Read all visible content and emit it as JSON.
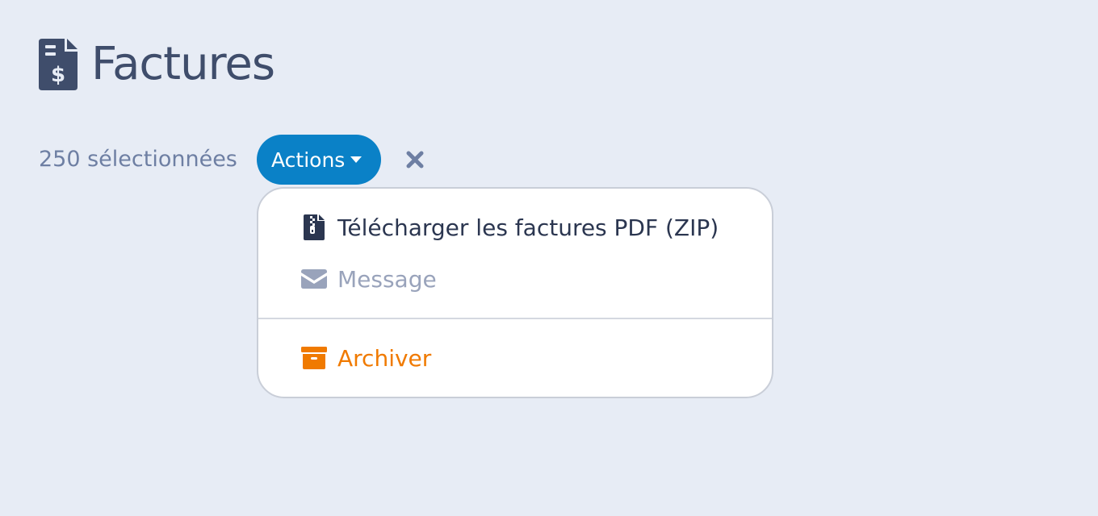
{
  "page": {
    "title": "Factures",
    "title_icon": "file-invoice-dollar-icon"
  },
  "selection": {
    "count_label": "250 sélectionnées",
    "actions_label": "Actions",
    "clear_icon": "close-icon"
  },
  "dropdown": {
    "items": [
      {
        "label": "Télécharger les factures PDF (ZIP)",
        "icon": "file-zipper-icon",
        "color": "#2b3650"
      },
      {
        "label": "Message",
        "icon": "envelope-icon",
        "color": "#99a3bb"
      },
      {
        "label": "Archiver",
        "icon": "archive-box-icon",
        "color": "#f07a00"
      }
    ]
  },
  "colors": {
    "background": "#e7ecf5",
    "title": "#3f4d6b",
    "muted_text": "#6e7fa3",
    "accent": "#0a81c7",
    "warning": "#f07a00"
  }
}
